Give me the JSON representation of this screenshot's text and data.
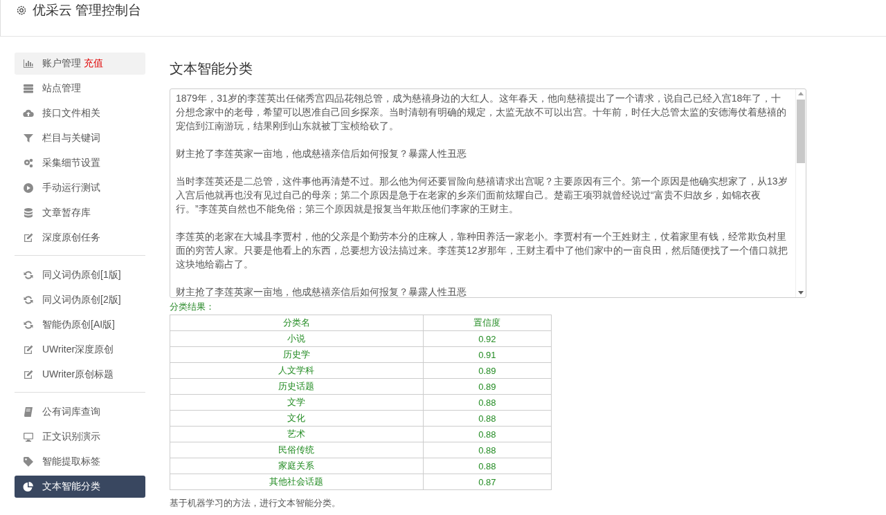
{
  "header": {
    "title": "优采云 管理控制台"
  },
  "sidebar": {
    "groups": [
      {
        "items": [
          {
            "label": "账户管理",
            "badge": "充值",
            "hovered": true,
            "selected": false
          },
          {
            "label": "站点管理",
            "hovered": false,
            "selected": false
          },
          {
            "label": "接口文件相关",
            "hovered": false,
            "selected": false
          },
          {
            "label": "栏目与关键词",
            "hovered": false,
            "selected": false
          },
          {
            "label": "采集细节设置",
            "hovered": false,
            "selected": false
          },
          {
            "label": "手动运行测试",
            "hovered": false,
            "selected": false
          },
          {
            "label": "文章暂存库",
            "hovered": false,
            "selected": false
          },
          {
            "label": "深度原创任务",
            "hovered": false,
            "selected": false
          }
        ]
      },
      {
        "items": [
          {
            "label": "同义词伪原创[1版]",
            "hovered": false,
            "selected": false
          },
          {
            "label": "同义词伪原创[2版]",
            "hovered": false,
            "selected": false
          },
          {
            "label": "智能伪原创[AI版]",
            "hovered": false,
            "selected": false
          },
          {
            "label": "UWriter深度原创",
            "hovered": false,
            "selected": false
          },
          {
            "label": "UWriter原创标题",
            "hovered": false,
            "selected": false
          }
        ]
      },
      {
        "items": [
          {
            "label": "公有词库查询",
            "hovered": false,
            "selected": false
          },
          {
            "label": "正文识别演示",
            "hovered": false,
            "selected": false
          },
          {
            "label": "智能提取标签",
            "hovered": false,
            "selected": false
          },
          {
            "label": "文本智能分类",
            "hovered": false,
            "selected": true
          }
        ]
      }
    ]
  },
  "main": {
    "heading": "文本智能分类",
    "text_input": {
      "paragraphs": [
        "1879年，31岁的李莲英出任储秀宫四品花翎总管，成为慈禧身边的大红人。这年春天，他向慈禧提出了一个请求，说自己已经入宫18年了，十分想念家中的老母，希望可以恩准自己回乡探亲。当时清朝有明确的规定，太监无故不可以出宫。十年前，时任大总管太监的安德海仗着慈禧的宠信到江南游玩，结果刚到山东就被丁宝桢给砍了。",
        "财主抢了李莲英家一亩地，他成慈禧亲信后如何报复？暴露人性丑恶",
        "当时李莲英还是二总管，这件事他再清楚不过。那么他为何还要冒险向慈禧请求出宫呢？主要原因有三个。第一个原因是他确实想家了，从13岁入宫后他就再也没有见过自己的母亲；第二个原因是急于在老家的乡亲们面前炫耀自己。楚霸王项羽就曾经说过“富贵不归故乡，如锦衣夜行。”李莲英自然也不能免俗；第三个原因就是报复当年欺压他们李家的王财主。",
        "李莲英的老家在大城县李贾村，他的父亲是个勤劳本分的庄稼人，靠种田养活一家老小。李贾村有一个王姓财主，仗着家里有钱，经常欺负村里面的穷苦人家。只要是他看上的东西，总要想方设法搞过来。李莲英12岁那年，王财主看中了他们家中的一亩良田，然后随便找了一个借口就把这块地给霸占了。",
        "财主抢了李莲英家一亩地，他成慈禧亲信后如何报复？暴露人性丑恶"
      ]
    },
    "result_label": "分类结果：",
    "table": {
      "columns": [
        "分类名",
        "置信度"
      ],
      "rows": [
        [
          "小说",
          "0.92"
        ],
        [
          "历史学",
          "0.91"
        ],
        [
          "人文学科",
          "0.89"
        ],
        [
          "历史话题",
          "0.89"
        ],
        [
          "文学",
          "0.88"
        ],
        [
          "文化",
          "0.88"
        ],
        [
          "艺术",
          "0.88"
        ],
        [
          "民俗传统",
          "0.88"
        ],
        [
          "家庭关系",
          "0.88"
        ],
        [
          "其他社会话题",
          "0.87"
        ]
      ]
    },
    "footnote": "基于机器学习的方法，进行文本智能分类。"
  }
}
